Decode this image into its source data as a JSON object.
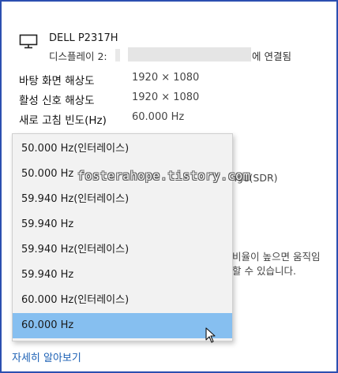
{
  "display": {
    "name": "DELL P2317H",
    "connection_prefix": "디스플레이 2: ",
    "connection_suffix": "에 연결됨",
    "icon": "monitor-icon"
  },
  "details": [
    {
      "label": "바탕 화면 해상도",
      "value": "1920 × 1080"
    },
    {
      "label": "활성 신호 해상도",
      "value": "1920 × 1080"
    },
    {
      "label": "새로 고침 빈도(Hz)",
      "value": "60.000 Hz"
    }
  ],
  "background_partial": {
    "line1": "nge(SDR)",
    "line2": "비율이 높으면 움직임",
    "line3": "할 수 있습니다."
  },
  "refresh_dropdown": {
    "options": [
      "50.000 Hz(인터레이스)",
      "50.000 Hz",
      "59.940 Hz(인터레이스)",
      "59.940 Hz",
      "59.940 Hz(인터레이스)",
      "59.940 Hz",
      "60.000 Hz(인터레이스)",
      "60.000 Hz"
    ],
    "selected_index": 7,
    "selected_color": "#86bff0"
  },
  "learn_more": "자세히 알아보기",
  "watermark": "fosterahope.tistory.com",
  "colors": {
    "frame_border": "#2b4fb0",
    "link": "#1a5fb4"
  }
}
